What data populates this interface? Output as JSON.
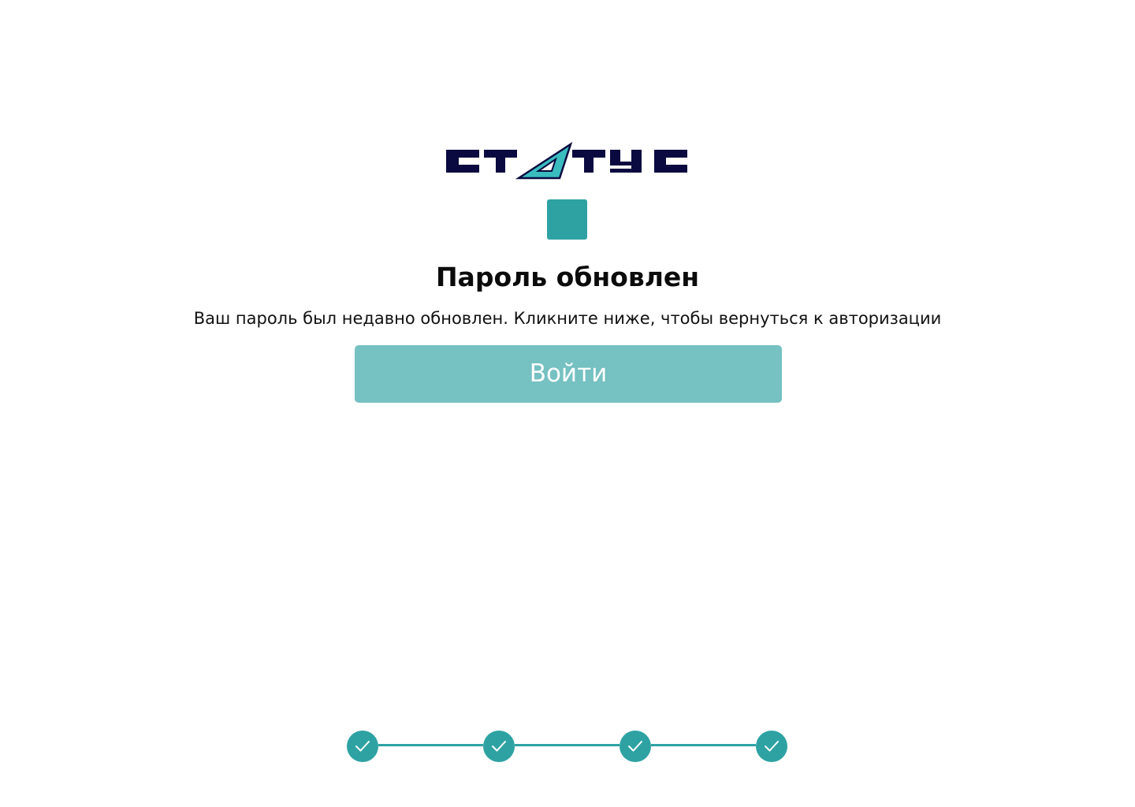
{
  "brand": {
    "logo_text": "СТАТУС",
    "dark_color": "#0a0a40",
    "accent_color": "#3abcbf"
  },
  "status_icon": {
    "name": "success-square-icon",
    "color": "#2ea2a3"
  },
  "content": {
    "title": "Пароль обновлен",
    "subtitle": "Ваш пароль был недавно обновлен. Кликните ниже, чтобы вернуться к авторизации",
    "login_button_label": "Войти",
    "button_color": "#76c1c2"
  },
  "stepper": {
    "total_steps": 4,
    "completed_steps": 4,
    "icon": "check-icon",
    "color": "#2ea2a3"
  }
}
